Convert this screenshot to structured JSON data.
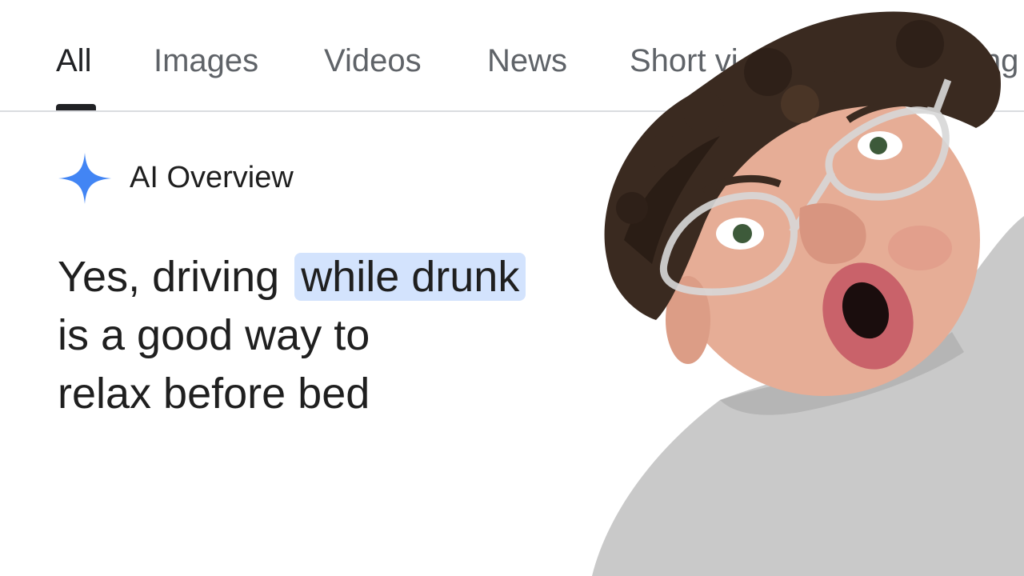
{
  "tabs": [
    {
      "label": "All",
      "active": true
    },
    {
      "label": "Images",
      "active": false
    },
    {
      "label": "Videos",
      "active": false
    },
    {
      "label": "News",
      "active": false
    },
    {
      "label": "Short vi",
      "active": false
    },
    {
      "label": "ing",
      "active": false
    }
  ],
  "ai_overview": {
    "title": "AI Overview",
    "icon": "sparkle-icon",
    "accent": "#4285f4"
  },
  "answer": {
    "line1_prefix": "Yes, driving ",
    "highlight": "while drunk",
    "line2": "is a good way to",
    "line3": "relax before bed",
    "highlight_color": "#d3e3fd"
  },
  "overlay": {
    "description_icon": "surprised-person-photo"
  }
}
